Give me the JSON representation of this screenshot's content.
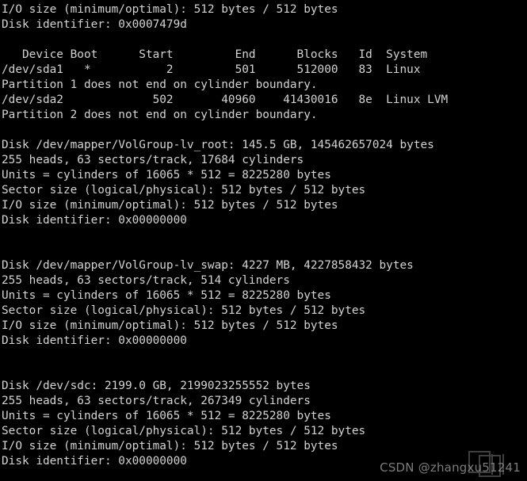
{
  "terminal": {
    "foreground_color": "#d3d3d3",
    "background_color": "#000000",
    "lines": [
      "I/O size (minimum/optimal): 512 bytes / 512 bytes",
      "Disk identifier: 0x0007479d",
      "",
      "   Device Boot      Start         End      Blocks   Id  System",
      "/dev/sda1   *           2         501      512000   83  Linux",
      "Partition 1 does not end on cylinder boundary.",
      "/dev/sda2             502       40960    41430016   8e  Linux LVM",
      "Partition 2 does not end on cylinder boundary.",
      "",
      "Disk /dev/mapper/VolGroup-lv_root: 145.5 GB, 145462657024 bytes",
      "255 heads, 63 sectors/track, 17684 cylinders",
      "Units = cylinders of 16065 * 512 = 8225280 bytes",
      "Sector size (logical/physical): 512 bytes / 512 bytes",
      "I/O size (minimum/optimal): 512 bytes / 512 bytes",
      "Disk identifier: 0x00000000",
      "",
      "",
      "Disk /dev/mapper/VolGroup-lv_swap: 4227 MB, 4227858432 bytes",
      "255 heads, 63 sectors/track, 514 cylinders",
      "Units = cylinders of 16065 * 512 = 8225280 bytes",
      "Sector size (logical/physical): 512 bytes / 512 bytes",
      "I/O size (minimum/optimal): 512 bytes / 512 bytes",
      "Disk identifier: 0x00000000",
      "",
      "",
      "Disk /dev/sdc: 2199.0 GB, 2199023255552 bytes",
      "255 heads, 63 sectors/track, 267349 cylinders",
      "Units = cylinders of 16065 * 512 = 8225280 bytes",
      "Sector size (logical/physical): 512 bytes / 512 bytes",
      "I/O size (minimum/optimal): 512 bytes / 512 bytes",
      "Disk identifier: 0x00000000"
    ],
    "partition_table": {
      "headers": [
        "Device",
        "Boot",
        "Start",
        "End",
        "Blocks",
        "Id",
        "System"
      ],
      "rows": [
        {
          "device": "/dev/sda1",
          "boot": "*",
          "start": "2",
          "end": "501",
          "blocks": "512000",
          "id": "83",
          "system": "Linux",
          "note": "Partition 1 does not end on cylinder boundary."
        },
        {
          "device": "/dev/sda2",
          "boot": "",
          "start": "502",
          "end": "40960",
          "blocks": "41430016",
          "id": "8e",
          "system": "Linux LVM",
          "note": "Partition 2 does not end on cylinder boundary."
        }
      ]
    },
    "disks": [
      {
        "name": "/dev/mapper/VolGroup-lv_root",
        "size_human": "145.5 GB",
        "size_bytes": "145462657024 bytes",
        "heads": "255",
        "sectors_per_track": "63",
        "cylinders": "17684",
        "units": "cylinders of 16065 * 512 = 8225280 bytes",
        "sector_size": "512 bytes / 512 bytes",
        "io_size": "512 bytes / 512 bytes",
        "identifier": "0x00000000"
      },
      {
        "name": "/dev/mapper/VolGroup-lv_swap",
        "size_human": "4227 MB",
        "size_bytes": "4227858432 bytes",
        "heads": "255",
        "sectors_per_track": "63",
        "cylinders": "514",
        "units": "cylinders of 16065 * 512 = 8225280 bytes",
        "sector_size": "512 bytes / 512 bytes",
        "io_size": "512 bytes / 512 bytes",
        "identifier": "0x00000000"
      },
      {
        "name": "/dev/sdc",
        "size_human": "2199.0 GB",
        "size_bytes": "2199023255552 bytes",
        "heads": "255",
        "sectors_per_track": "63",
        "cylinders": "267349",
        "units": "cylinders of 16065 * 512 = 8225280 bytes",
        "sector_size": "512 bytes / 512 bytes",
        "io_size": "512 bytes / 512 bytes",
        "identifier": "0x00000000"
      }
    ]
  },
  "watermark": {
    "text": "CSDN @zhangxu51241",
    "color": "#8d8d8d"
  }
}
